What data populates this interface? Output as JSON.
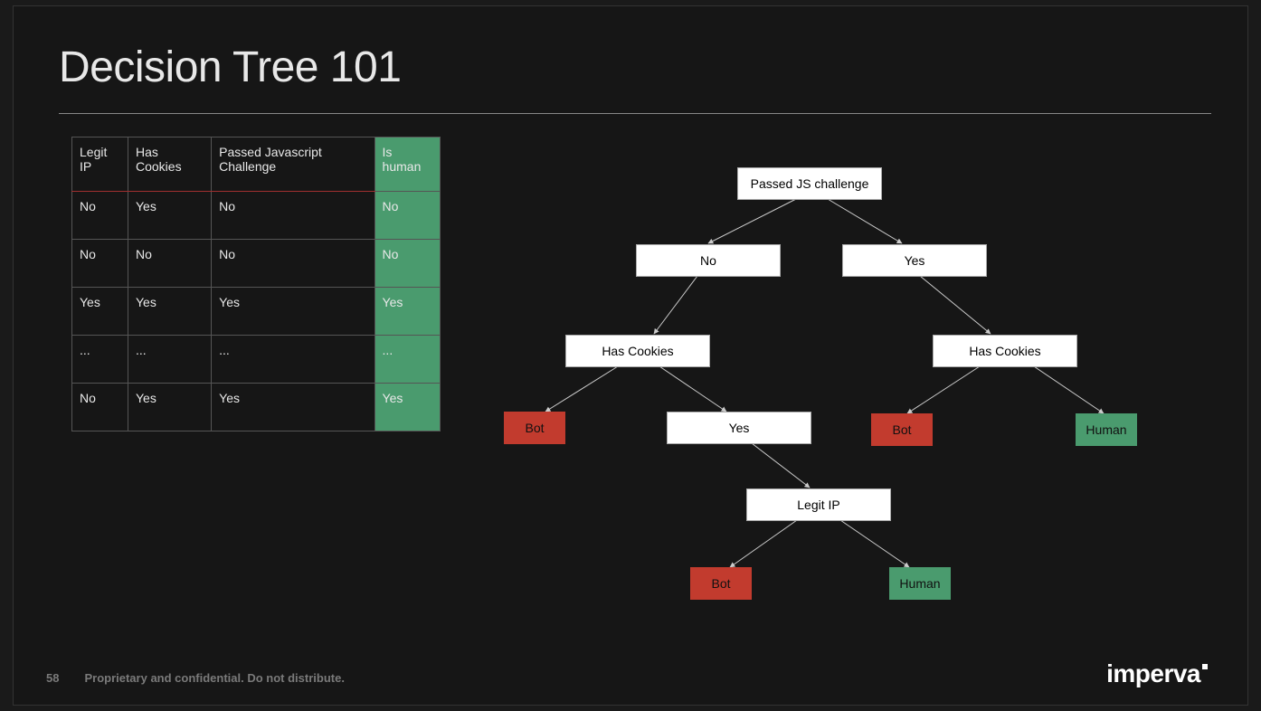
{
  "title": "Decision Tree 101",
  "table": {
    "headers": [
      "Legit IP",
      "Has Cookies",
      "Passed Javascript Challenge",
      "Is human"
    ],
    "rows": [
      [
        "No",
        "Yes",
        "No",
        "No"
      ],
      [
        "No",
        "No",
        "No",
        "No"
      ],
      [
        "Yes",
        "Yes",
        "Yes",
        "Yes"
      ],
      [
        "...",
        "...",
        "...",
        "..."
      ],
      [
        "No",
        "Yes",
        "Yes",
        "Yes"
      ]
    ]
  },
  "tree": {
    "nodes": {
      "root": {
        "label": "Passed JS challenge"
      },
      "no1": {
        "label": "No"
      },
      "yes1": {
        "label": "Yes"
      },
      "hasCookiesL": {
        "label": "Has Cookies"
      },
      "hasCookiesR": {
        "label": "Has Cookies"
      },
      "botL": {
        "label": "Bot"
      },
      "yes2": {
        "label": "Yes"
      },
      "botR": {
        "label": "Bot"
      },
      "humanR": {
        "label": "Human"
      },
      "legitIP": {
        "label": "Legit IP"
      },
      "botC": {
        "label": "Bot"
      },
      "humanC": {
        "label": "Human"
      }
    }
  },
  "footer": {
    "page": "58",
    "confidential": "Proprietary and confidential. Do not distribute."
  },
  "logo": "imperva"
}
